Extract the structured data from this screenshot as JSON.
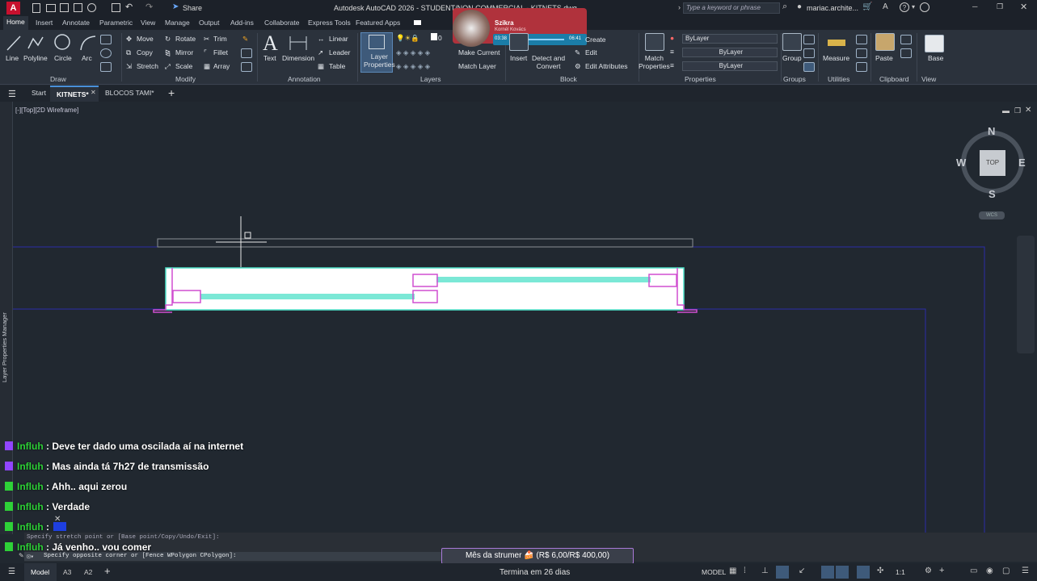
{
  "title": {
    "app_logo": "A",
    "doc": "Autodesk AutoCAD 2026 - STUDENT/NON COMMERCIAL - KITNETS.dwg",
    "share": "Share",
    "search_placeholder": "Type a keyword or phrase",
    "user": "mariac.archite..."
  },
  "menu": [
    "Home",
    "Insert",
    "Annotate",
    "Parametric",
    "View",
    "Manage",
    "Output",
    "Add-ins",
    "Collaborate",
    "Express Tools",
    "Featured Apps"
  ],
  "ribbon": {
    "draw": {
      "line": "Line",
      "polyline": "Polyline",
      "circle": "Circle",
      "arc": "Arc",
      "title": "Draw"
    },
    "modify": {
      "move": "Move",
      "rotate": "Rotate",
      "trim": "Trim",
      "copy": "Copy",
      "mirror": "Mirror",
      "fillet": "Fillet",
      "stretch": "Stretch",
      "scale": "Scale",
      "array": "Array",
      "title": "Modify"
    },
    "annotation": {
      "text": "Text",
      "dimension": "Dimension",
      "linear": "Linear",
      "leader": "Leader",
      "table": "Table",
      "title": "Annotation"
    },
    "layers": {
      "layer_props": "Layer\nProperties",
      "make_current": "Make Current",
      "match_layer": "Match Layer",
      "title": "Layers",
      "layer_value": "0"
    },
    "block": {
      "insert": "Insert",
      "create": "Create",
      "edit": "Edit",
      "edit_attributes": "Edit Attributes",
      "detect": "Detect and\nConvert",
      "title": "Block"
    },
    "properties": {
      "match": "Match\nProperties",
      "color": "ByLayer",
      "linetype": "ByLayer",
      "lineweight": "ByLayer",
      "title": "Properties"
    },
    "groups": {
      "group": "Group",
      "title": "Groups"
    },
    "utilities": {
      "measure": "Measure",
      "title": "Utilities"
    },
    "clipboard": {
      "paste": "Paste",
      "title": "Clipboard"
    },
    "view": {
      "base": "Base",
      "title": "View"
    }
  },
  "music": {
    "title": "Szikra",
    "artist": "Kornél Kovács",
    "elapsed": "03:38",
    "total": "06:41"
  },
  "file_tabs": {
    "start": "Start",
    "tab1": "KITNETS*",
    "tab2": "BLOCOS TAMI*"
  },
  "viewport": {
    "label": "[-][Top][2D Wireframe]",
    "side_palette": "Layer Properties Manager",
    "compass": {
      "n": "N",
      "s": "S",
      "e": "E",
      "w": "W",
      "top": "TOP",
      "wcs": "WCS"
    }
  },
  "chat": [
    {
      "user": "Influh",
      "msg": "Deve ter dado uma oscilada aí na internet"
    },
    {
      "user": "Influh",
      "msg": "Mas ainda tá 7h27 de transmissão"
    },
    {
      "user": "Influh",
      "msg": "Ahh.. aqui zerou"
    },
    {
      "user": "Influh",
      "msg": "Verdade"
    },
    {
      "user": "Influh",
      "msg": ""
    },
    {
      "user": "Influh",
      "msg": "Já venho.. vou comer"
    }
  ],
  "command": {
    "history": "Specify stretch point or [Base point/Copy/Undo/Exit]:",
    "current": "Specify opposite corner or [Fence WPolygon CPolygon]:"
  },
  "overlay": {
    "goal": "Mês da strumer 🍰 (R$ 6,00/R$ 400,00)",
    "ends": "Termina em 26 dias"
  },
  "status": {
    "model_tab": "Model",
    "layout1": "A3",
    "layout2": "A2",
    "mode": "MODEL",
    "scale": "1:1"
  },
  "colors": {
    "accent": "#2ed138",
    "dark": "#212830",
    "ribbon": "#2b323c",
    "selection": "#4ee0c8",
    "highlight": "#d04fd0",
    "music_bg": "#b0323c"
  }
}
